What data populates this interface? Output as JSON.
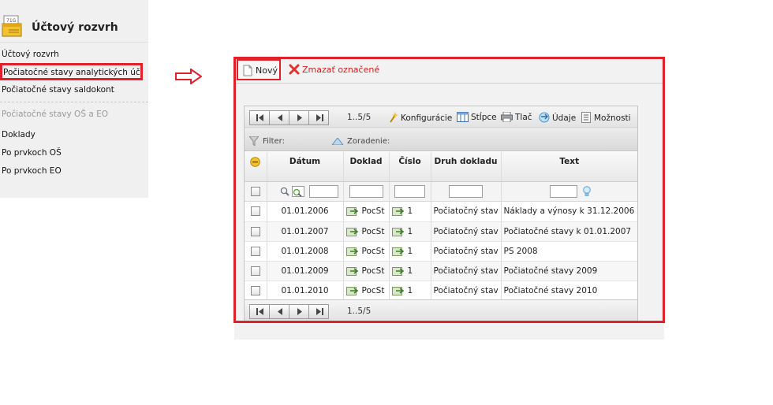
{
  "sidebar": {
    "title": "Účtový rozvrh",
    "logo_icon": "ledger-book-icon",
    "items": [
      {
        "label": "Účtový rozvrh"
      },
      {
        "label": "Počiatočné stavy analytických účtov"
      },
      {
        "label": "Počiatočné stavy saldokont"
      }
    ],
    "section_label": "Počiatočné stavy OŠ a EO",
    "section_items": [
      {
        "label": "Doklady"
      },
      {
        "label": "Po prvkoch OŠ"
      },
      {
        "label": "Po prvkoch EO"
      }
    ]
  },
  "toolbar": {
    "new_label": "Nový",
    "delete_label": "Zmazať označené"
  },
  "grid": {
    "pager_count": "1..5/5",
    "tools": {
      "config": "Konfigurácie",
      "columns": "Stĺpce",
      "print": "Tlač",
      "data": "Údaje",
      "options": "Možnosti"
    },
    "filter_label": "Filter:",
    "sort_label": "Zoradenie:",
    "columns": [
      "Dátum",
      "Doklad",
      "Číslo",
      "Druh dokladu",
      "Text"
    ],
    "rows": [
      {
        "date": "01.01.2006",
        "doc": "PocSt",
        "num": "1",
        "type": "Počiatočný stav",
        "text": "Náklady a výnosy k 31.12.2006"
      },
      {
        "date": "01.01.2007",
        "doc": "PocSt",
        "num": "1",
        "type": "Počiatočný stav",
        "text": "Počiatočné stavy k 01.01.2007"
      },
      {
        "date": "01.01.2008",
        "doc": "PocSt",
        "num": "1",
        "type": "Počiatočný stav",
        "text": "PS 2008"
      },
      {
        "date": "01.01.2009",
        "doc": "PocSt",
        "num": "1",
        "type": "Počiatočný stav",
        "text": "Počiatočné stavy 2009"
      },
      {
        "date": "01.01.2010",
        "doc": "PocSt",
        "num": "1",
        "type": "Počiatočný stav",
        "text": "Počiatočné stavy 2010"
      }
    ]
  },
  "colors": {
    "highlight": "#e0202a",
    "delete_text": "#d21f1f"
  }
}
